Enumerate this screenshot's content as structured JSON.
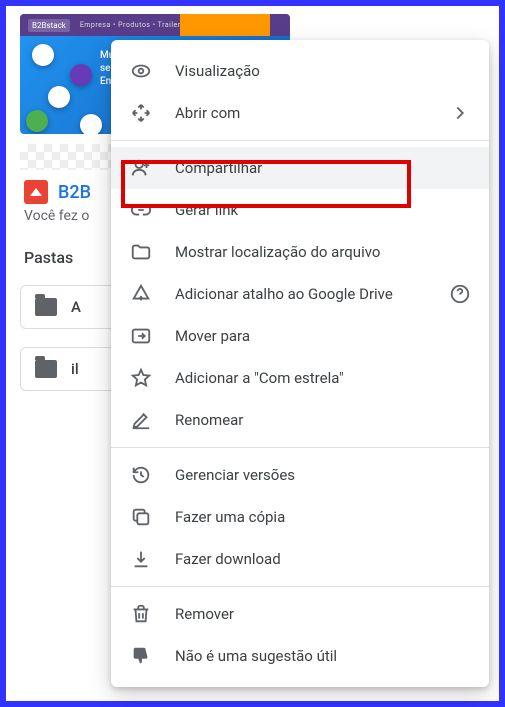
{
  "background": {
    "file_name": "B2B",
    "subtitle": "Você fez o",
    "section_label": "Pastas",
    "folders": [
      "A",
      "il"
    ],
    "thumb_text": "Mude se\nsempre\nEnvende",
    "thumb_nav": "Empresa • Produtos • Trailer • Blog",
    "thumb_logo": "B2Bstack"
  },
  "menu": {
    "items": [
      {
        "id": "preview",
        "label": "Visualização"
      },
      {
        "id": "open-with",
        "label": "Abrir com",
        "submenu": true
      }
    ],
    "items2": [
      {
        "id": "share",
        "label": "Compartilhar",
        "hover": true
      },
      {
        "id": "get-link",
        "label": "Gerar link"
      },
      {
        "id": "show-location",
        "label": "Mostrar localização do arquivo"
      },
      {
        "id": "add-shortcut",
        "label": "Adicionar atalho ao Google Drive",
        "help": true
      },
      {
        "id": "move-to",
        "label": "Mover para"
      },
      {
        "id": "add-starred",
        "label": "Adicionar a \"Com estrela\""
      },
      {
        "id": "rename",
        "label": "Renomear"
      }
    ],
    "items3": [
      {
        "id": "manage-versions",
        "label": "Gerenciar versões"
      },
      {
        "id": "make-copy",
        "label": "Fazer uma cópia"
      },
      {
        "id": "download",
        "label": "Fazer download"
      }
    ],
    "items4": [
      {
        "id": "remove",
        "label": "Remover"
      },
      {
        "id": "not-useful",
        "label": "Não é uma sugestão útil"
      }
    ]
  }
}
